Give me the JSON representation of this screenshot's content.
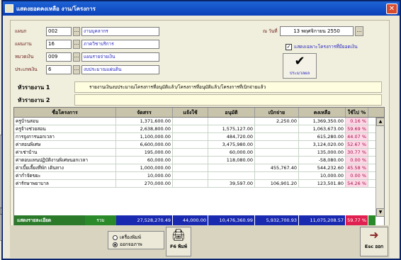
{
  "window": {
    "title": "แสดงยอดคงเหลือ งาน/โครงการ"
  },
  "form": {
    "fields": [
      {
        "label": "แผนก",
        "code": "002",
        "name": "งานบุคลากร"
      },
      {
        "label": "แผนงาน",
        "code": "16",
        "name": "ภาควิชาบริการ"
      },
      {
        "label": "หมวดเงิน",
        "code": "009",
        "name": "แผนรายจ่ายเงิน"
      },
      {
        "label": "ประเภทเงิน",
        "code": "6",
        "name": "งบประมาณแผ่นดิน"
      }
    ],
    "date_label": "ณ วันที่",
    "date_value": "13 พฤศจิกายน 2550",
    "checkbox_label": "แสดงเฉพาะโครงการที่มียอดเงิน",
    "checkbox_checked": true,
    "process_label": "ประมวลผล",
    "group1_label": "หัวรายงาน 1",
    "group1_value": "รายงานเงินงบประมาณโครงการที่อนุมัติแล้ว/โครงการที่อนุมัติแล้ว/โครงการที่เบิกจ่ายแล้ว",
    "group2_label": "หัวรายงาน 2",
    "group2_value": ""
  },
  "table": {
    "headers": [
      "ชื่อโครงการ",
      "จัดสรร",
      "แจ้งใช้",
      "อนุมัติ",
      "เบิกจ่าย",
      "คงเหลือ",
      "ใช้ไป %"
    ],
    "rows": [
      {
        "name": "ครูบ้านสอน",
        "budget": "1,371,600.00",
        "split": "",
        "approve": "",
        "pay": "2,250.00",
        "left": "1,369,350.00",
        "pct": "0.16 %"
      },
      {
        "name": "ครูจ้างช่วยสอน",
        "budget": "2,638,800.00",
        "split": "",
        "approve": "1,575,127.00",
        "pay": "",
        "left": "1,063,673.00",
        "pct": "59.69 %"
      },
      {
        "name": "การจูงการนอกเวลา",
        "budget": "1,100,000.00",
        "split": "",
        "approve": "484,720.00",
        "pay": "",
        "left": "615,280.00",
        "pct": "44.07 %"
      },
      {
        "name": "ค่าสอนพิเศษ",
        "budget": "6,600,000.00",
        "split": "",
        "approve": "3,475,980.00",
        "pay": "",
        "left": "3,124,020.00",
        "pct": "52.67 %"
      },
      {
        "name": "ค่าเช่าบ้าน",
        "budget": "195,000.00",
        "split": "",
        "approve": "60,000.00",
        "pay": "",
        "left": "135,000.00",
        "pct": "30.77 %"
      },
      {
        "name": "ค่าตอบแทนปฏิบัติงานพิเศษนอกเวลา",
        "budget": "60,000.00",
        "split": "",
        "approve": "118,080.00",
        "pay": "",
        "left": "-58,080.00",
        "pct": "0.00 %"
      },
      {
        "name": "ค่าเบี้ยเลี้ยงที่พัก เดินทาง",
        "budget": "1,000,000.00",
        "split": "",
        "approve": "",
        "pay": "455,767.40",
        "left": "544,232.60",
        "pct": "45.58 %"
      },
      {
        "name": "ค่ากำจัดขยะ",
        "budget": "10,000.00",
        "split": "",
        "approve": "",
        "pay": "",
        "left": "10,000.00",
        "pct": "0.00 %"
      },
      {
        "name": "ค่ารักษาพยาบาล",
        "budget": "270,000.00",
        "split": "",
        "approve": "39,597.00",
        "pay": "106,901.20",
        "left": "123,501.80",
        "pct": "54.26 %"
      }
    ],
    "detail_button": "แสดงรายละเอียด",
    "total_label": "รวม",
    "totals": {
      "budget": "27,528,270.49",
      "split": "44,000.00",
      "approve": "10,476,360.99",
      "pay": "5,932,700.93",
      "left": "11,075,208.57",
      "pct": "59.77 %"
    }
  },
  "bottom": {
    "radio_printer": "เครื่องพิมพ์",
    "radio_screen": "ออกจอภาพ",
    "print_button": "F6 พิมพ์",
    "exit_button": "Esc ออก"
  }
}
